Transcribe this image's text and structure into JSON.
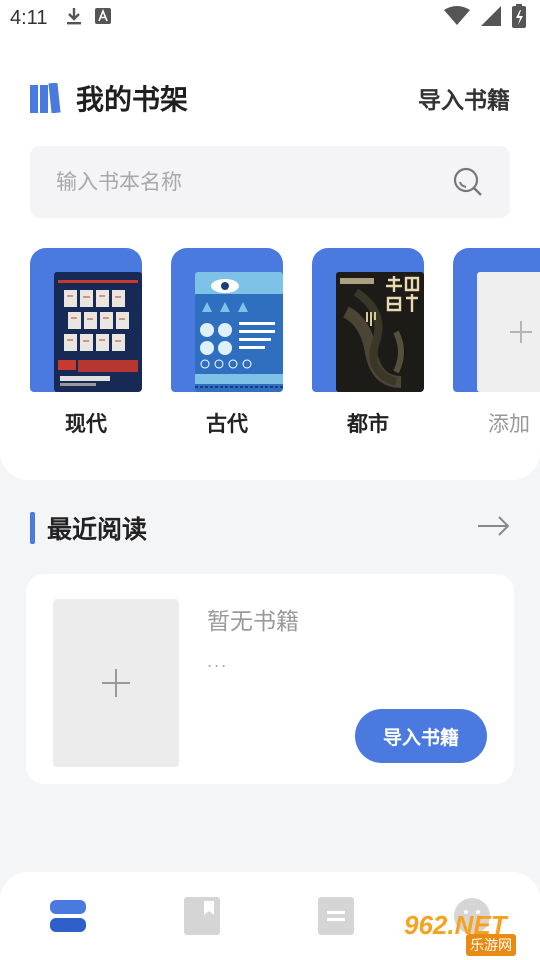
{
  "status_bar": {
    "time": "4:11",
    "icons": [
      "download-icon",
      "a-notification-icon",
      "wifi-icon",
      "signal-icon",
      "battery-charging-icon"
    ]
  },
  "header": {
    "title": "我的书架",
    "import_label": "导入书籍",
    "logo_icon": "bookshelf-logo-icon"
  },
  "search": {
    "placeholder": "输入书本名称",
    "value": "",
    "icon": "search-icon"
  },
  "categories": [
    {
      "label": "现代",
      "cover": "modern-book-cover"
    },
    {
      "label": "古代",
      "cover": "ancient-book-cover"
    },
    {
      "label": "都市",
      "cover": "urban-book-cover"
    },
    {
      "label": "添加",
      "cover": "add-placeholder"
    }
  ],
  "recent": {
    "title": "最近阅读",
    "empty_title": "暂无书籍",
    "empty_desc": "...",
    "import_button": "导入书籍",
    "more_icon": "arrow-right-icon"
  },
  "bottom_nav": [
    {
      "icon": "bookshelf-icon",
      "active": true
    },
    {
      "icon": "bookmark-icon",
      "active": false
    },
    {
      "icon": "document-icon",
      "active": false
    },
    {
      "icon": "profile-icon",
      "active": false
    }
  ],
  "watermark": {
    "main": "962.NET",
    "sub": "乐游网"
  },
  "colors": {
    "accent": "#4a7ae0",
    "background": "#f4f5f7",
    "card": "#ffffff"
  }
}
